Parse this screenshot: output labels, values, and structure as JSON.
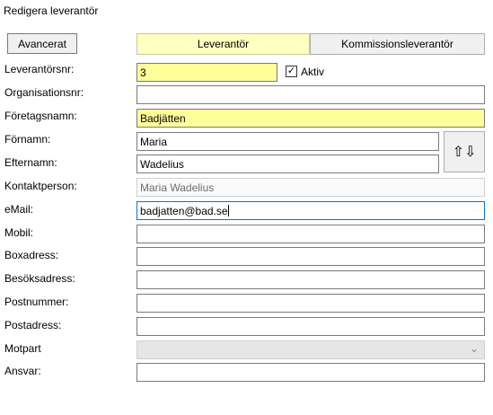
{
  "window": {
    "title": "Redigera leverantör"
  },
  "buttons": {
    "advanced": "Avancerat",
    "move_arrows": "⇧⇩"
  },
  "tabs": [
    {
      "label": "Leverantör",
      "active": true
    },
    {
      "label": "Kommissionsleverantör",
      "active": false
    }
  ],
  "form": {
    "supplier_no": {
      "label": "Leverantörsnr:",
      "value": "3"
    },
    "active": {
      "label": "Aktiv",
      "checked": true,
      "check_mark": "✓"
    },
    "org_no": {
      "label": "Organisationsnr:",
      "value": ""
    },
    "company": {
      "label": "Företagsnamn:",
      "value": "Badjätten"
    },
    "first_name": {
      "label": "Förnamn:",
      "value": "Maria"
    },
    "last_name": {
      "label": "Efternamn:",
      "value": "Wadelius"
    },
    "contact": {
      "label": "Kontaktperson:",
      "value": "Maria Wadelius"
    },
    "email": {
      "label": "eMail:",
      "value": "badjatten@bad.se"
    },
    "mobile": {
      "label": "Mobil:",
      "value": ""
    },
    "box_address": {
      "label": "Boxadress:",
      "value": ""
    },
    "visit_address": {
      "label": "Besöksadress:",
      "value": ""
    },
    "postal_code": {
      "label": "Postnummer:",
      "value": ""
    },
    "postal_address": {
      "label": "Postadress:",
      "value": ""
    },
    "counterpart": {
      "label": "Motpart",
      "value": "",
      "chevron_icon": "chevron-down-icon"
    },
    "responsible": {
      "label": "Ansvar:",
      "value": ""
    }
  },
  "colors": {
    "highlight": "#ffff99",
    "tab_active": "#ffffc0",
    "focus": "#0078d7"
  }
}
